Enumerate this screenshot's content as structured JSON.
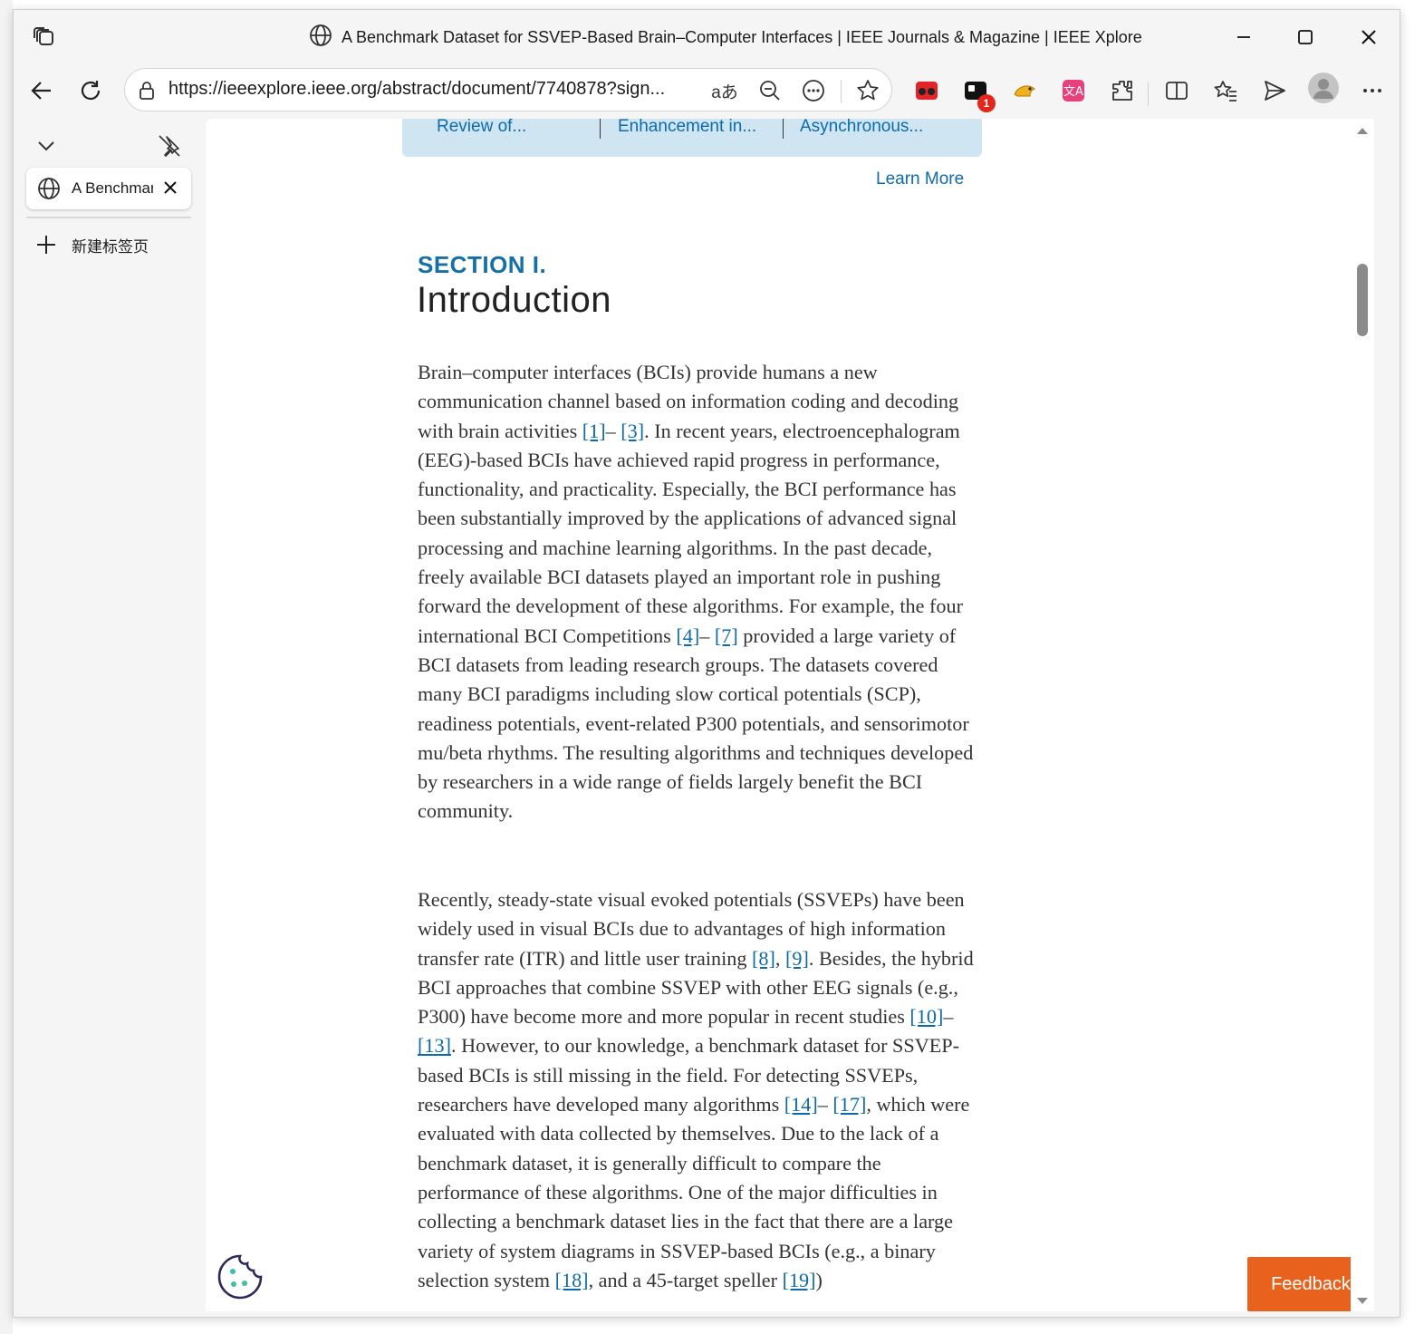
{
  "window": {
    "title": "A Benchmark Dataset for SSVEP-Based Brain–Computer Interfaces | IEEE Journals & Magazine | IEEE Xplore"
  },
  "toolbar": {
    "url": "https://ieeexplore.ieee.org/abstract/document/7740878?sign...",
    "extension_badge_count": "1"
  },
  "sidebar": {
    "tab_title": "A Benchmark",
    "new_tab_label": "新建标签页"
  },
  "page": {
    "related_articles": [
      "Review of...",
      "Enhancement in...",
      "Asynchronous..."
    ],
    "learn_more": "Learn More",
    "section_label": "SECTION I.",
    "section_title": "Introduction",
    "feedback_label": "Feedback",
    "para1": {
      "s1": "Brain–computer interfaces (BCIs) provide humans a new communication channel based on information coding and decoding with brain activities ",
      "r1": "[1]",
      "d1": "– ",
      "r2": "[3]",
      "s2": ". In recent years, electroencephalogram (EEG)-based BCIs have achieved rapid progress in performance, functionality, and practicality. Especially, the BCI performance has been substantially improved by the applications of advanced signal processing and machine learning algorithms. In the past decade, freely available BCI datasets played an important role in pushing forward the development of these algorithms. For example, the four international BCI Competitions  ",
      "r3": "[4]",
      "d2": "– ",
      "r4": "[7]",
      "s3": " provided a large variety of BCI datasets from leading research groups. The datasets covered many BCI paradigms including slow cortical potentials (SCP), readiness potentials, event-related P300 potentials, and sensorimotor mu/beta rhythms. The resulting algorithms and techniques developed by researchers in a wide range of fields largely benefit the BCI community."
    },
    "para2": {
      "s1": "Recently, steady-state visual evoked potentials (SSVEPs) have been widely used in visual BCIs due to advantages of high information transfer rate (ITR) and little user training ",
      "r1": "[8]",
      "c1": ",  ",
      "r2": "[9]",
      "s2": ". Besides, the hybrid BCI approaches that combine SSVEP with other EEG signals (e.g., P300) have become more and more popular in recent studies  ",
      "r3": "[10]",
      "d1": "– ",
      "r4": "[13]",
      "s3": ". However, to our knowledge, a benchmark dataset for SSVEP-based BCIs is still missing in the field. For detecting SSVEPs, researchers have developed many algorithms  ",
      "r5": "[14]",
      "d2": "– ",
      "r6": "[17]",
      "s4": ", which were evaluated with data collected by themselves. Due to the lack of a benchmark dataset, it is generally difficult to compare the performance of these algorithms. One of the major difficulties in collecting a benchmark dataset lies in the fact that there are a large variety of system diagrams in SSVEP-based BCIs (e.g., a binary selection system  ",
      "r7": "[18]",
      "s5": ", and a 45-target speller  ",
      "r8": "[19]",
      "s6": ")"
    }
  },
  "colors": {
    "link": "#0d6bab",
    "section_label": "#1570a6",
    "related_bar": "#cfe6f2",
    "feedback": "#e8621e"
  },
  "icons": [
    "workspaces-icon",
    "globe-icon",
    "minimize-icon",
    "maximize-icon",
    "close-icon",
    "back-icon",
    "refresh-icon",
    "lock-icon",
    "read-aloud-icon",
    "zoom-out-icon",
    "more-options-icon",
    "favorite-star-icon",
    "extension-icon",
    "split-screen-icon",
    "favorites-icon",
    "share-icon",
    "profile-avatar-icon",
    "settings-more-icon",
    "chevron-down-icon",
    "unpin-icon",
    "plus-icon",
    "cookie-icon"
  ]
}
